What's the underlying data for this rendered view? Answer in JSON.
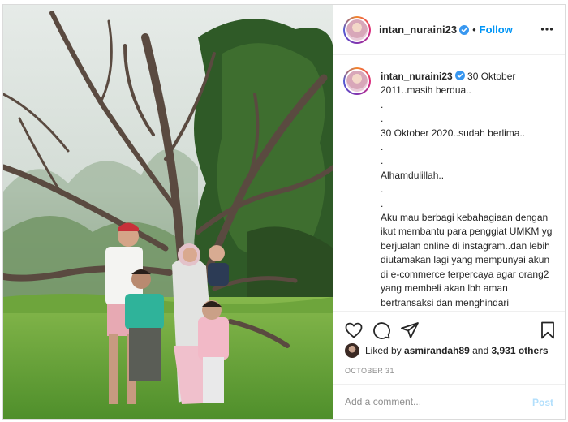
{
  "post": {
    "username": "intan_nuraini23",
    "verified": true,
    "separator": "•",
    "follow_label": "Follow",
    "more_icon": "more-horizontal-icon"
  },
  "caption": {
    "username": "intan_nuraini23",
    "text": " 30 Oktober 2011..masih berdua..\n.\n.\n30 Oktober 2020..sudah berlima..\n.\n.\nAlhamdulillah..\n.\n.\nAku mau berbagi kebahagiaan dengan ikut membantu para penggiat UMKM yg berjualan online di instagram..dan lebih diutamakan lagi yang mempunyai akun di e-commerce terpercaya agar orang2 yang membeli akan lbh aman bertransaksi dan menghindari penipuan..tidak ada biaya apapun..cukup mengirimkan saja barang yang akan diiklankan supaya"
  },
  "actions": {
    "like_icon": "heart-icon",
    "comment_icon": "comment-icon",
    "share_icon": "share-icon",
    "save_icon": "bookmark-icon"
  },
  "likes": {
    "prefix": "Liked by ",
    "user": "asmirandah89",
    "middle": " and ",
    "count": "3,931 others"
  },
  "date": "OCTOBER 31",
  "comment": {
    "placeholder": "Add a comment...",
    "post_label": "Post"
  },
  "colors": {
    "accent": "#0095f6",
    "post_disabled": "#b2dffc",
    "border": "#dbdbdb",
    "muted": "#8e8e8e"
  }
}
